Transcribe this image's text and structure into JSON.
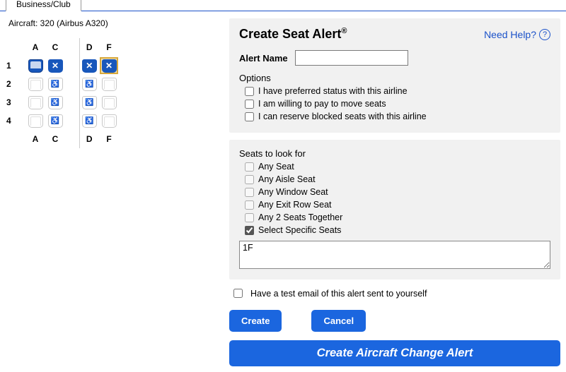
{
  "tab_label": "Business/Club",
  "aircraft_line": "Aircraft: 320 (Airbus A320)",
  "seatmap": {
    "columns_left": [
      "A",
      "C"
    ],
    "columns_right": [
      "D",
      "F"
    ],
    "rows": [
      {
        "num": "1",
        "A": "available",
        "C": "occupied",
        "D": "occupied",
        "F": "occupied",
        "selected": "F"
      },
      {
        "num": "2",
        "A": "empty",
        "C": "wheelchair",
        "D": "wheelchair",
        "F": "empty"
      },
      {
        "num": "3",
        "A": "empty",
        "C": "wheelchair",
        "D": "wheelchair",
        "F": "empty"
      },
      {
        "num": "4",
        "A": "empty",
        "C": "wheelchair",
        "D": "wheelchair",
        "F": "empty"
      }
    ]
  },
  "alert": {
    "heading": "Create Seat Alert",
    "need_help": "Need Help?",
    "alert_name_label": "Alert Name",
    "alert_name_value": "",
    "options_label": "Options",
    "options": [
      {
        "label": "I have preferred status with this airline",
        "checked": false
      },
      {
        "label": "I am willing to pay to move seats",
        "checked": false
      },
      {
        "label": "I can reserve blocked seats with this airline",
        "checked": false
      }
    ],
    "seats_label": "Seats to look for",
    "seat_opts": [
      {
        "label": "Any Seat",
        "checked": false,
        "enabled": false
      },
      {
        "label": "Any Aisle Seat",
        "checked": false,
        "enabled": false
      },
      {
        "label": "Any Window Seat",
        "checked": false,
        "enabled": false
      },
      {
        "label": "Any Exit Row Seat",
        "checked": false,
        "enabled": false
      },
      {
        "label": "Any 2 Seats Together",
        "checked": false,
        "enabled": false
      },
      {
        "label": "Select Specific Seats",
        "checked": true,
        "enabled": true
      }
    ],
    "specific_value": "1F",
    "test_email_label": "Have a test email of this alert sent to yourself",
    "test_email_checked": false,
    "create_btn": "Create",
    "cancel_btn": "Cancel",
    "aircraft_change_btn": "Create Aircraft Change Alert"
  }
}
